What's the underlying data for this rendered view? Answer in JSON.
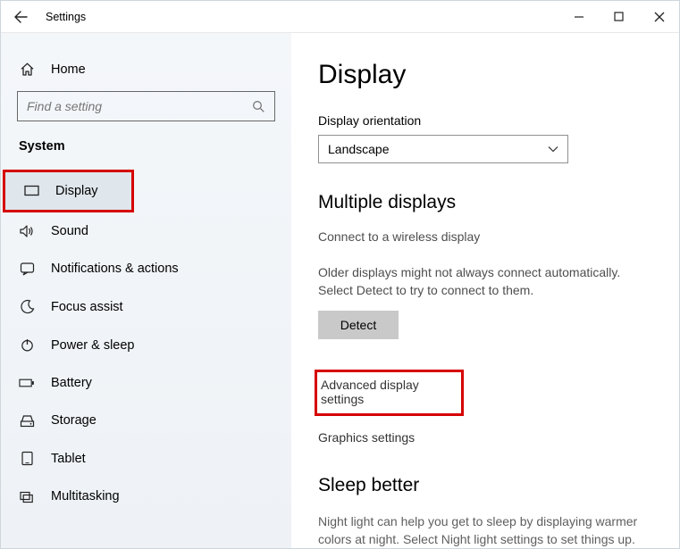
{
  "titlebar": {
    "title": "Settings"
  },
  "sidebar": {
    "home": "Home",
    "search_placeholder": "Find a setting",
    "section": "System",
    "items": [
      {
        "label": "Display"
      },
      {
        "label": "Sound"
      },
      {
        "label": "Notifications & actions"
      },
      {
        "label": "Focus assist"
      },
      {
        "label": "Power & sleep"
      },
      {
        "label": "Battery"
      },
      {
        "label": "Storage"
      },
      {
        "label": "Tablet"
      },
      {
        "label": "Multitasking"
      }
    ]
  },
  "main": {
    "title": "Display",
    "orientation_label": "Display orientation",
    "orientation_value": "Landscape",
    "multiple_displays_heading": "Multiple displays",
    "wireless_link": "Connect to a wireless display",
    "detect_info": "Older displays might not always connect automatically. Select Detect to try to connect to them.",
    "detect_button": "Detect",
    "advanced_link": "Advanced display settings",
    "graphics_link": "Graphics settings",
    "sleep_heading": "Sleep better",
    "sleep_desc": "Night light can help you get to sleep by displaying warmer colors at night. Select Night light settings to set things up."
  }
}
